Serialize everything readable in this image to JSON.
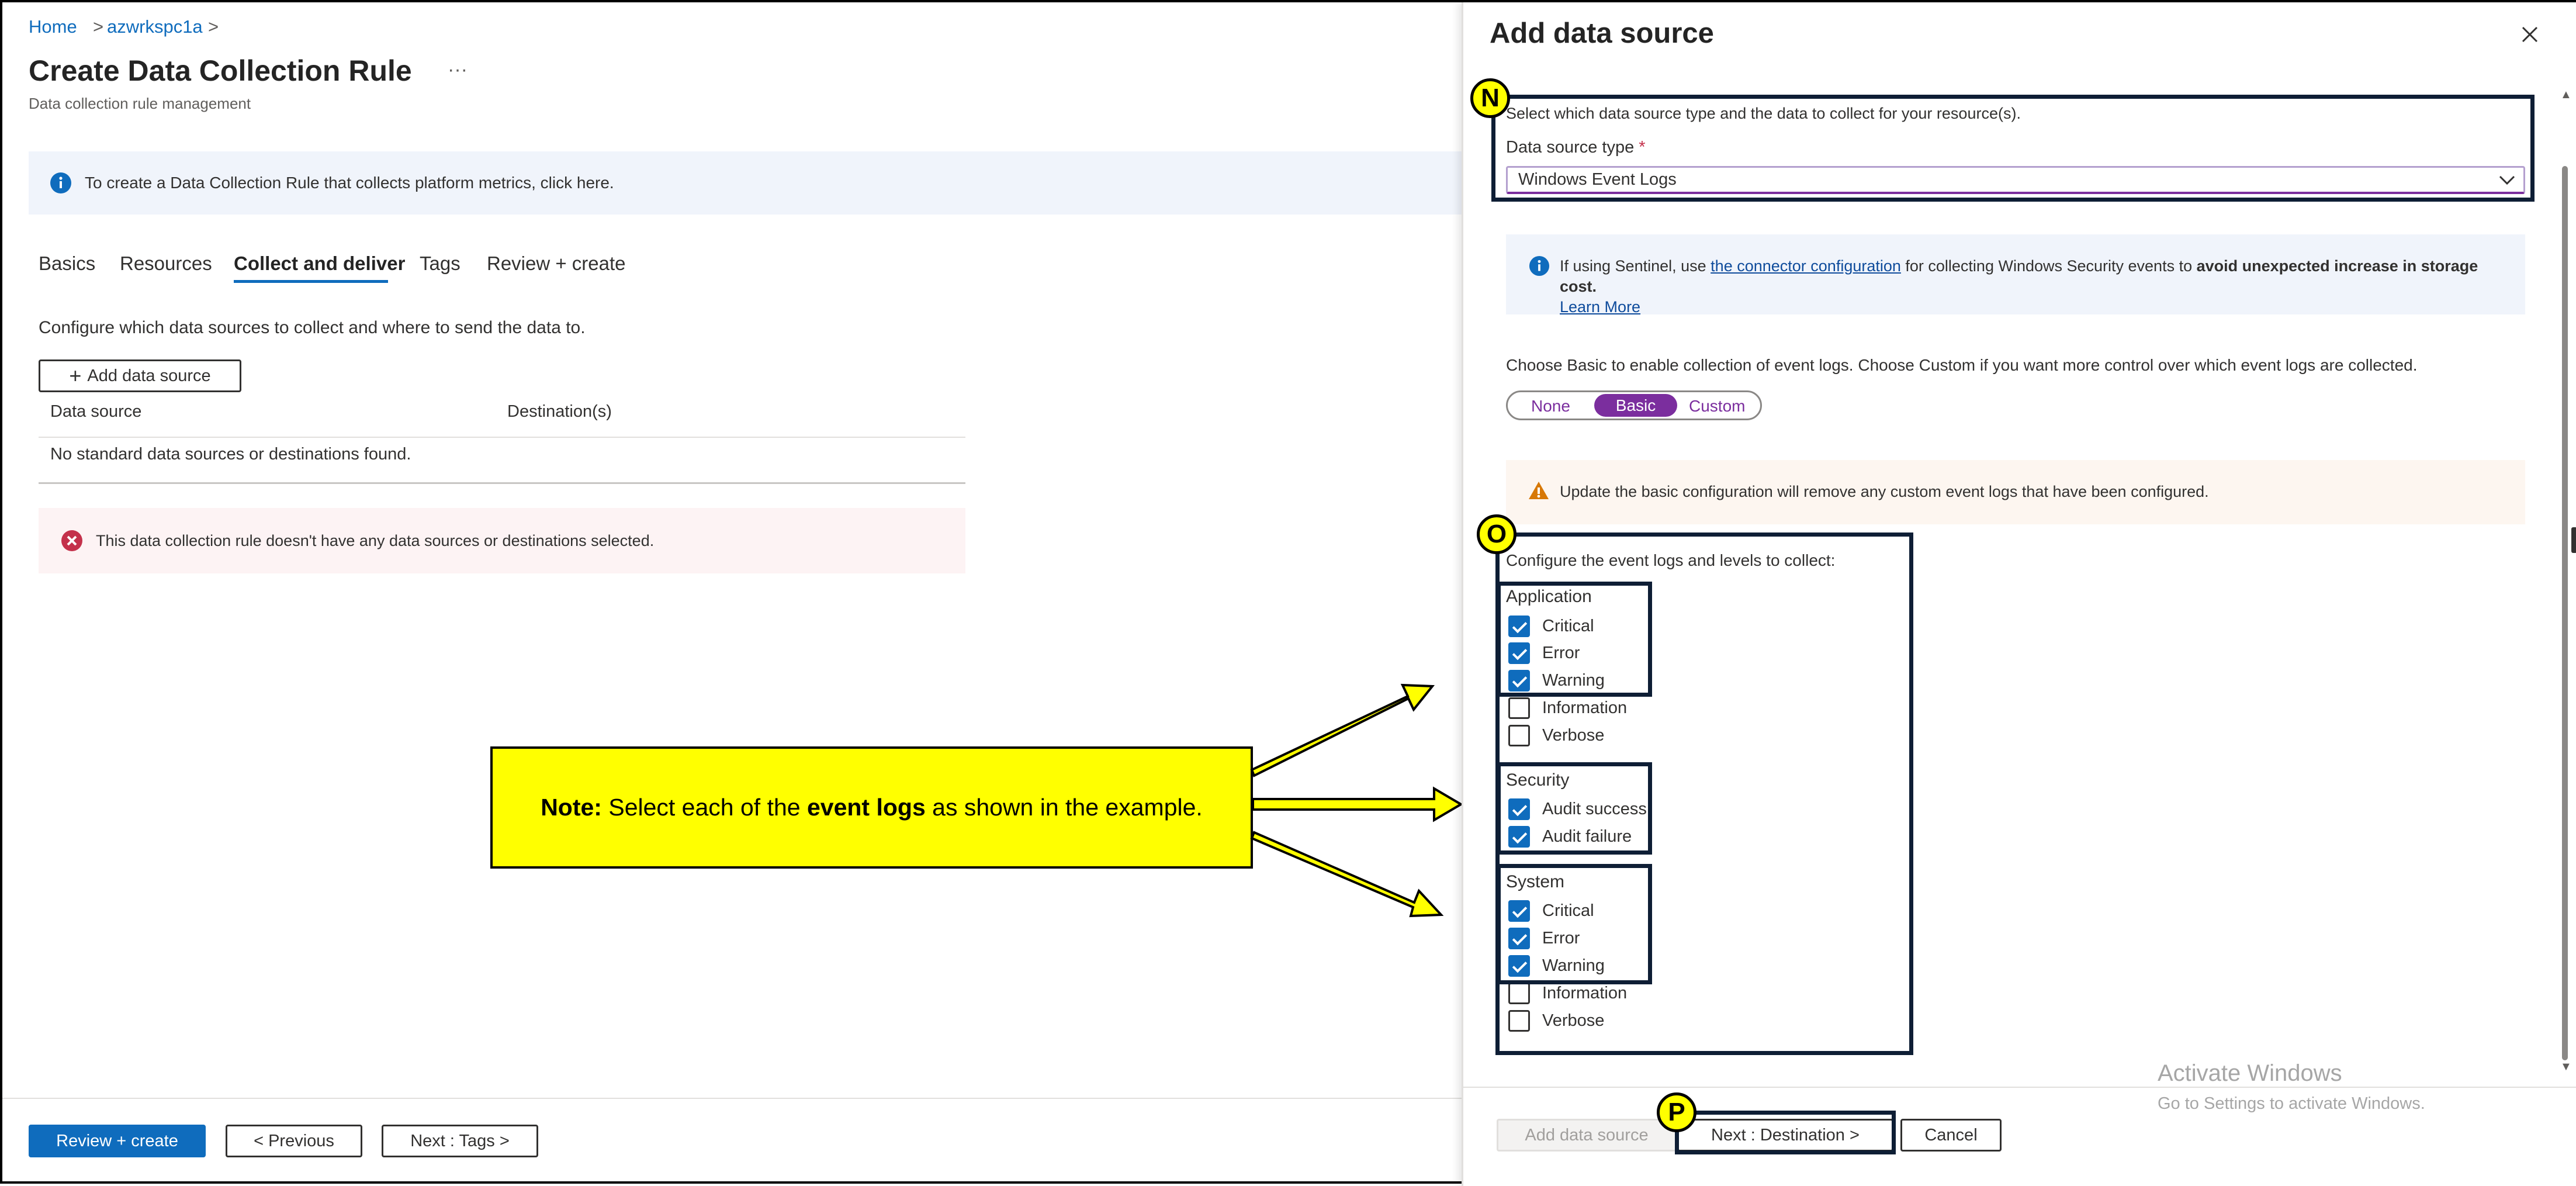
{
  "breadcrumb": {
    "home": "Home",
    "resource": "azwrkspc1a",
    "sep": ">"
  },
  "page": {
    "title": "Create Data Collection Rule",
    "more": "···",
    "subtitle": "Data collection rule management"
  },
  "info_banner": {
    "text": "To create a Data Collection Rule that collects platform metrics, click here."
  },
  "tabs": [
    {
      "label": "Basics"
    },
    {
      "label": "Resources"
    },
    {
      "label": "Collect and deliver",
      "active": true
    },
    {
      "label": "Tags"
    },
    {
      "label": "Review + create"
    }
  ],
  "collect": {
    "description": "Configure which data sources to collect and where to send the data to.",
    "add_button": "Add data source",
    "columns": {
      "source": "Data source",
      "dest": "Destination(s)"
    },
    "empty": "No standard data sources or destinations found.",
    "error": "This data collection rule doesn't have any data sources or destinations selected."
  },
  "footer": {
    "review": "Review + create",
    "previous": "< Previous",
    "next": "Next : Tags >"
  },
  "callout": {
    "note_bold": "Note:",
    "pre": " Select each of the ",
    "bold": "event logs",
    "post": " as shown in the example."
  },
  "panel": {
    "title": "Add data source",
    "intro": "Select which data source type and the data to collect for your resource(s).",
    "type_label": "Data source type",
    "required_mark": "*",
    "type_value": "Windows Event Logs",
    "sentinel": {
      "pre": "If using Sentinel, use ",
      "link": "the connector configuration",
      "mid": " for collecting Windows Security events to ",
      "bold": "avoid unexpected increase in storage cost.",
      "learn": "Learn More"
    },
    "mode_text": "Choose Basic to enable collection of event logs. Choose Custom if you want more control over which event logs are collected.",
    "modes": {
      "none": "None",
      "basic": "Basic",
      "custom": "Custom",
      "selected": "Basic"
    },
    "warning": "Update the basic configuration will remove any custom event logs that have been configured.",
    "configure_label": "Configure the event logs and levels to collect:",
    "groups": {
      "application": {
        "label": "Application",
        "items": [
          {
            "label": "Critical",
            "checked": true
          },
          {
            "label": "Error",
            "checked": true
          },
          {
            "label": "Warning",
            "checked": true
          },
          {
            "label": "Information",
            "checked": false
          },
          {
            "label": "Verbose",
            "checked": false
          }
        ]
      },
      "security": {
        "label": "Security",
        "items": [
          {
            "label": "Audit success",
            "checked": true
          },
          {
            "label": "Audit failure",
            "checked": true
          }
        ]
      },
      "system": {
        "label": "System",
        "items": [
          {
            "label": "Critical",
            "checked": true
          },
          {
            "label": "Error",
            "checked": true
          },
          {
            "label": "Warning",
            "checked": true
          },
          {
            "label": "Information",
            "checked": false
          },
          {
            "label": "Verbose",
            "checked": false
          }
        ]
      }
    },
    "footer": {
      "add": "Add data source",
      "next": "Next : Destination >",
      "cancel": "Cancel"
    }
  },
  "watermark": {
    "line1": "Activate Windows",
    "line2": "Go to Settings to activate Windows."
  },
  "badges": {
    "n": "N",
    "o": "O",
    "p": "P"
  },
  "colors": {
    "accent": "#0f6cbd",
    "basic_pill": "#7b2e9e",
    "callout": "#ffff00",
    "highlight": "#0e1e35",
    "error_bg": "#fdf3f4"
  }
}
